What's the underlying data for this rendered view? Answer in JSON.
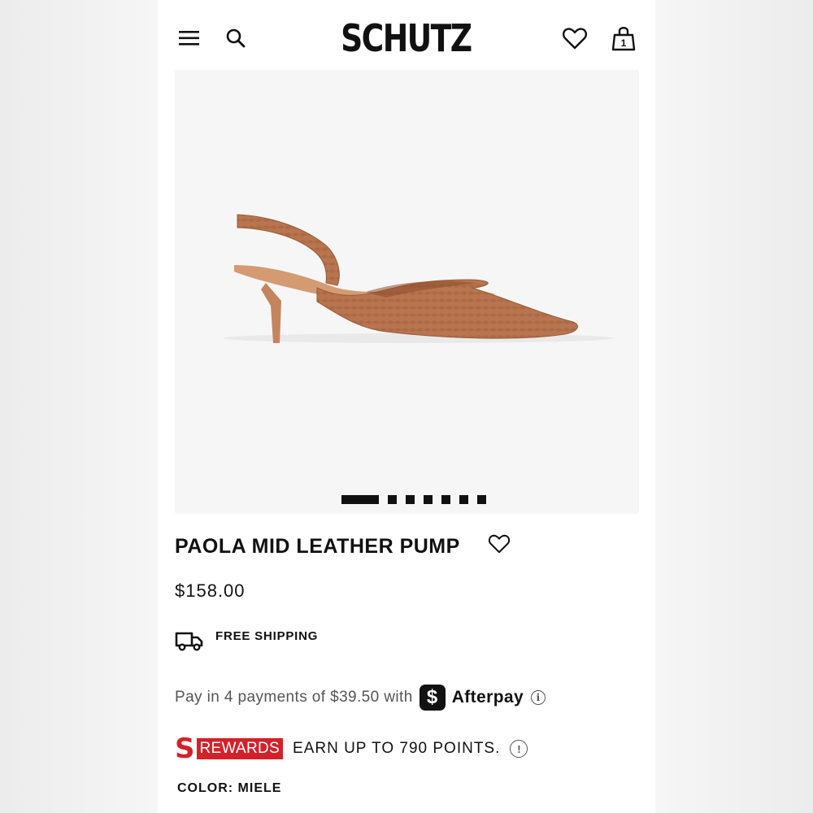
{
  "header": {
    "brand": "SCHUTZ",
    "menu_icon": "hamburger-menu-icon",
    "search_icon": "search-icon",
    "wishlist_icon": "heart-icon",
    "bag_icon": "shopping-bag-icon",
    "bag_count": "1"
  },
  "gallery": {
    "image": "pointed-toe slingback kitten-heel pump in caramel snake-embossed leather",
    "current_index": 1,
    "total_slides": 7
  },
  "product": {
    "title": "PAOLA MID LEATHER PUMP",
    "price": "$158.00",
    "shipping": "FREE SHIPPING",
    "afterpay": {
      "text": "Pay in 4 payments of $39.50 with",
      "badge_glyph": "$",
      "brand": "Afterpay",
      "info_glyph": "i"
    },
    "rewards": {
      "s_letter": "S",
      "badge": "REWARDS",
      "text": "EARN UP TO 790 POINTS.",
      "alert_glyph": "!"
    },
    "color_label": "COLOR: MIELE"
  },
  "colors": {
    "accent_red": "#d42129",
    "text": "#111111",
    "muted": "#555555",
    "shoe": "#b8754f"
  }
}
